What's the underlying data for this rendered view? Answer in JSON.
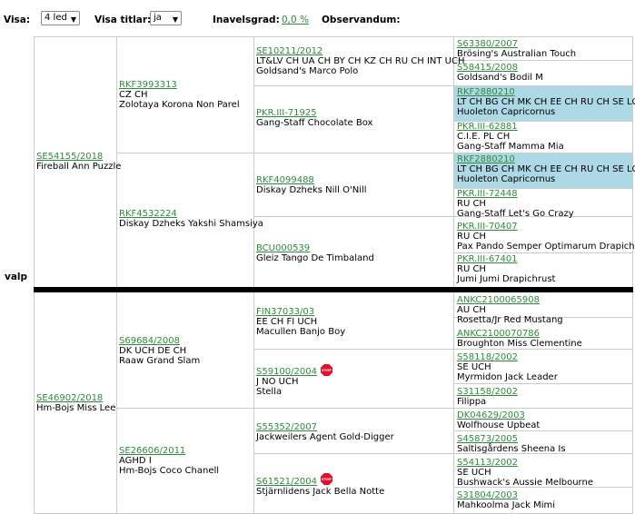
{
  "controls": {
    "visa_label": "Visa:",
    "visa_value": "4 led",
    "visa_titlar_label": "Visa titlar:",
    "visa_titlar_value": "ja",
    "inavelsgrad_label": "Inavelsgrad:",
    "inavelsgrad_value": "0,0 %",
    "observandum_label": "Observandum:"
  },
  "left_label": "valp",
  "sire": {
    "reg": "SE54155/2018",
    "titles": "",
    "name": "Fireball Ann Puzzle",
    "ss": {
      "reg": "RKF3993313",
      "titles": "CZ CH",
      "name": "Zolotaya Korona Non Parel",
      "sss": {
        "reg": "SE10211/2012",
        "titles": "LT&LV CH UA CH BY CH KZ CH RU CH INT UCH",
        "name": "Goldsand's Marco Polo",
        "ssss": {
          "reg": "S63380/2007",
          "titles": "",
          "name": "Brösing's Australian Touch"
        },
        "sssd": {
          "reg": "S58415/2008",
          "titles": "",
          "name": "Goldsand's Bodil M"
        }
      },
      "ssd": {
        "reg": "PKR.III-71925",
        "titles": "",
        "name": "Gang-Staff Chocolate Box",
        "ssds": {
          "reg": "RKF2880210",
          "titles": "LT CH BG CH MK CH EE CH RU CH SE LCH",
          "name": "Huoleton Capricornus"
        },
        "ssdd": {
          "reg": "PKR.III-62881",
          "titles": "C.I.E. PL CH",
          "name": "Gang-Staff Mamma Mia"
        }
      }
    },
    "sd": {
      "reg": "RKF4532224",
      "titles": "",
      "name": "Diskay Dzheks Yakshi Shamsiya",
      "sds": {
        "reg": "RKF4099488",
        "titles": "",
        "name": "Diskay Dzheks Nill O'Nill",
        "sdss": {
          "reg": "RKF2880210",
          "titles": "LT CH BG CH MK CH EE CH RU CH SE LCH",
          "name": "Huoleton Capricornus"
        },
        "sdsd": {
          "reg": "PKR.III-72448",
          "titles": "RU CH",
          "name": "Gang-Staff Let's Go Crazy"
        }
      },
      "sdd": {
        "reg": "BCU000539",
        "titles": "",
        "name": "Gleiz Tango De Timbaland",
        "sdds": {
          "reg": "PKR.III-70407",
          "titles": "RU CH",
          "name": "Pax Pando Semper Optimarum Drapichr"
        },
        "sddd": {
          "reg": "PKR.III-67401",
          "titles": "RU CH",
          "name": "Jumi Jumi Drapichrust"
        }
      }
    }
  },
  "dam": {
    "reg": "SE46902/2018",
    "titles": "",
    "name": "Hm-Bojs Miss Lee",
    "ds": {
      "reg": "S69684/2008",
      "titles": "DK UCH DE CH",
      "name": "Raaw Grand Slam",
      "dss": {
        "reg": "FIN37033/03",
        "titles": "EE CH FI UCH",
        "name": "Macullen Banjo Boy",
        "dsss": {
          "reg": "ANKC2100065908",
          "titles": "AU CH",
          "name": "Rosetta/Jr Red Mustang"
        },
        "dssd": {
          "reg": "ANKC2100070786",
          "titles": "",
          "name": "Broughton Miss Clementine"
        }
      },
      "dsd": {
        "reg": "S59100/2004",
        "titles": "J NO UCH",
        "name": "Stella",
        "badge": "STOP",
        "dsds": {
          "reg": "S58118/2002",
          "titles": "SE UCH",
          "name": "Myrmidon Jack Leader"
        },
        "dsdd": {
          "reg": "S31158/2002",
          "titles": "",
          "name": "Filippa"
        }
      }
    },
    "dd": {
      "reg": "SE26606/2011",
      "titles": "AGHD I",
      "name": "Hm-Bojs Coco Chanell",
      "dds": {
        "reg": "S55352/2007",
        "titles": "",
        "name": "Jackweilers Agent Gold-Digger",
        "ddss": {
          "reg": "DK04629/2003",
          "titles": "",
          "name": "Wolfhouse Upbeat"
        },
        "ddsd": {
          "reg": "S45873/2005",
          "titles": "",
          "name": "Saltisgårdens Sheena Is"
        }
      },
      "ddd": {
        "reg": "S61521/2004",
        "titles": "",
        "name": "Stjärnlidens Jack Bella Notte",
        "badge": "STOP",
        "ddds": {
          "reg": "S54113/2002",
          "titles": "SE UCH",
          "name": "Bushwack's Aussie Melbourne"
        },
        "dddd": {
          "reg": "S31804/2003",
          "titles": "",
          "name": "Mahkoolma Jack Mimi"
        }
      }
    }
  },
  "colors": {
    "link": "#2e8b3a",
    "highlight": "#add8e6",
    "stop": "#e0102a"
  }
}
